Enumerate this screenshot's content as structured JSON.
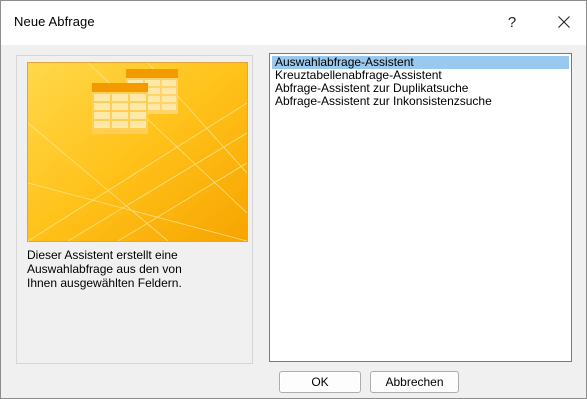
{
  "window": {
    "title": "Neue Abfrage",
    "help_label": "?",
    "close_label": "close"
  },
  "preview": {
    "image_name": "query-wizard-illustration",
    "description": "Dieser Assistent erstellt eine\nAuswahlabfrage aus den von\nIhnen ausgewählten Feldern."
  },
  "list": {
    "items": [
      {
        "label": "Auswahlabfrage-Assistent",
        "selected": true
      },
      {
        "label": "Kreuztabellenabfrage-Assistent",
        "selected": false
      },
      {
        "label": "Abfrage-Assistent zur Duplikatsuche",
        "selected": false
      },
      {
        "label": "Abfrage-Assistent zur Inkonsistenzsuche",
        "selected": false
      }
    ]
  },
  "buttons": {
    "ok_label": "OK",
    "cancel_label": "Abbrechen"
  },
  "colors": {
    "selection": "#99c9ef",
    "illustration_orange": "#f7a800",
    "illustration_yellow": "#ffd200"
  }
}
